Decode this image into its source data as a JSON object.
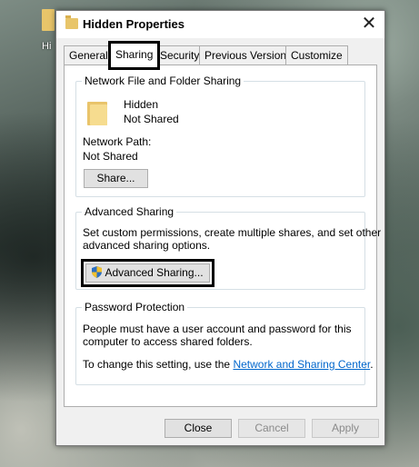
{
  "desktop": {
    "icon_label": "Hi"
  },
  "window": {
    "title": "Hidden Properties",
    "close_glyph": "✕"
  },
  "tabs": [
    {
      "label": "General",
      "active": false
    },
    {
      "label": "Sharing",
      "active": true
    },
    {
      "label": "Security",
      "active": false
    },
    {
      "label": "Previous Versions",
      "active": false
    },
    {
      "label": "Customize",
      "active": false
    }
  ],
  "network_sharing": {
    "group_title": "Network File and Folder Sharing",
    "folder_name": "Hidden",
    "status": "Not Shared",
    "path_label": "Network Path:",
    "path_value": "Not Shared",
    "share_button": "Share..."
  },
  "advanced_sharing": {
    "group_title": "Advanced Sharing",
    "description_line1": "Set custom permissions, create multiple shares, and set other",
    "description_line2": "advanced sharing options.",
    "button": "Advanced Sharing..."
  },
  "password_protection": {
    "group_title": "Password Protection",
    "line1": "People must have a user account and password for this",
    "line2": "computer to access shared folders.",
    "change_prefix": "To change this setting, use the ",
    "link_text": "Network and Sharing Center",
    "change_suffix": "."
  },
  "footer": {
    "close": "Close",
    "cancel": "Cancel",
    "apply": "Apply"
  },
  "colors": {
    "link": "#0066cc",
    "folder": "#e9c46a",
    "highlight_box": "#000000"
  }
}
